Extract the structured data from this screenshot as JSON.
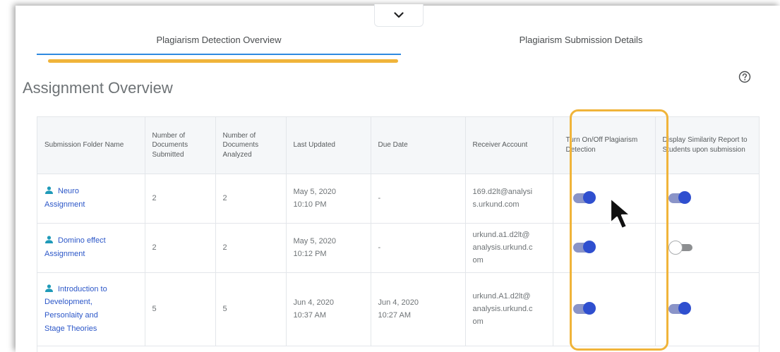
{
  "tabs": [
    {
      "label": "Plagiarism Detection Overview",
      "active": true
    },
    {
      "label": "Plagiarism Submission Details",
      "active": false
    }
  ],
  "heading": "Assignment Overview",
  "icons": {
    "collapse": "chevron-down-icon",
    "help": "help-circle-icon",
    "user": "user-icon",
    "cursor": "mouse-pointer-icon"
  },
  "colors": {
    "highlight": "#f0b43a",
    "tab_underline": "#2f8ae0",
    "link": "#2c57c8",
    "toggle_on": "#2f4fcf"
  },
  "table": {
    "headers": [
      "Submission Folder Name",
      "Number of Documents Submitted",
      "Number of Documents Analyzed",
      "Last Updated",
      "Due Date",
      "Receiver Account",
      "Turn On/Off Plagiarism Detection",
      "Display Similarity Report to Students upon submission"
    ],
    "rows": [
      {
        "folder": [
          "Neuro",
          "Assignment"
        ],
        "submitted": "2",
        "analyzed": "2",
        "last_updated": [
          "May 5, 2020",
          "10:10 PM"
        ],
        "due_date": [
          "-"
        ],
        "receiver": [
          "169.d2lt@analysi",
          "s.urkund.com"
        ],
        "detection_on": true,
        "report_on": true
      },
      {
        "folder": [
          "Domino effect",
          "Assignment"
        ],
        "submitted": "2",
        "analyzed": "2",
        "last_updated": [
          "May 5, 2020",
          "10:12 PM"
        ],
        "due_date": [
          "-"
        ],
        "receiver": [
          "urkund.a1.d2lt@",
          "analysis.urkund.c",
          "om"
        ],
        "detection_on": true,
        "report_on": false
      },
      {
        "folder": [
          "Introduction to",
          "Development,",
          "Personlaity and",
          "Stage Theories"
        ],
        "submitted": "5",
        "analyzed": "5",
        "last_updated": [
          "Jun 4, 2020",
          "10:37 AM"
        ],
        "due_date": [
          "Jun 4, 2020",
          "10:27 AM"
        ],
        "receiver": [
          "urkund.A1.d2lt@",
          "analysis.urkund.c",
          "om"
        ],
        "detection_on": true,
        "report_on": true
      }
    ]
  }
}
